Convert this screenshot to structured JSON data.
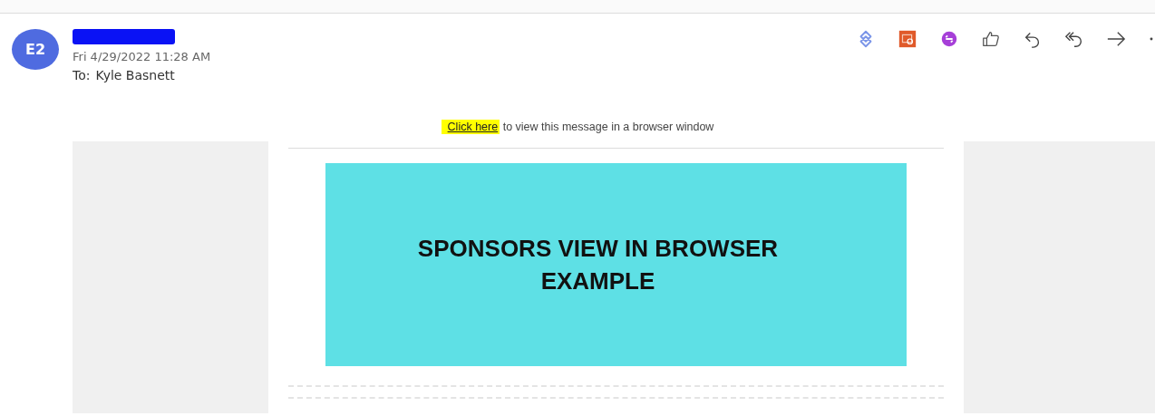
{
  "message": {
    "avatar_initials": "E2",
    "sent": "Fri 4/29/2022 11:28 AM",
    "to_label": "To:",
    "to": "Kyle Basnett"
  },
  "toolbar": [
    {
      "kind": "loop"
    },
    {
      "kind": "calendar"
    },
    {
      "kind": "editor"
    },
    {
      "kind": "like"
    },
    {
      "kind": "reply"
    },
    {
      "kind": "reply_all"
    },
    {
      "kind": "forward"
    },
    {
      "kind": "more"
    }
  ],
  "body": {
    "link": "Click here",
    "notice": "to view this message in a browser window",
    "banner_heading": "SPONSORS VIEW IN BROWSER EXAMPLE"
  }
}
